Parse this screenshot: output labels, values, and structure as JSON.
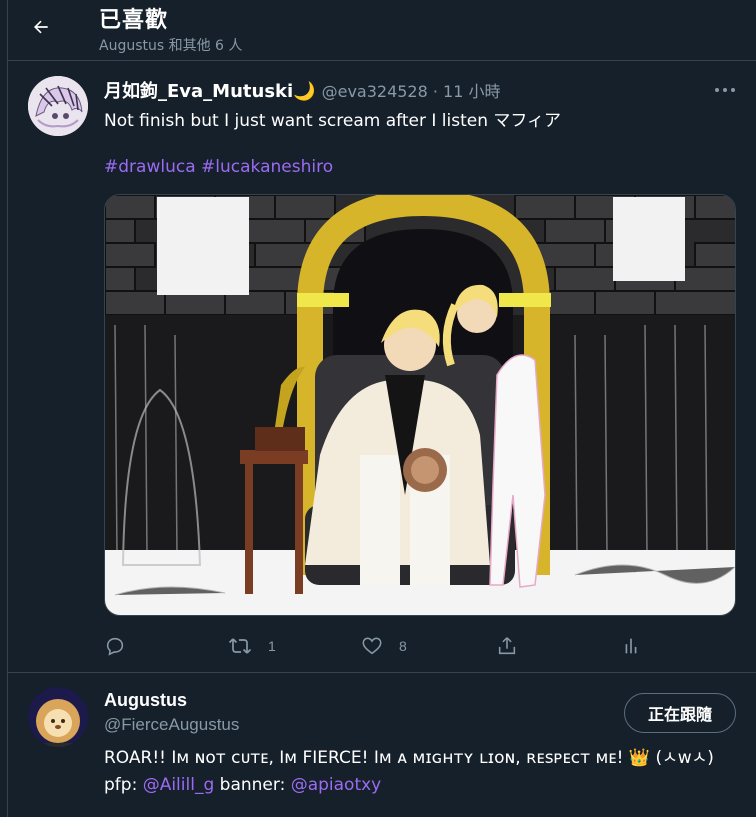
{
  "header": {
    "title": "已喜歡",
    "subtitle": "Augustus 和其他 6 人"
  },
  "tweet": {
    "display_name": "月如鉤_Eva_Mutuski🌙",
    "handle_time": "@eva324528 · 11 小時",
    "text": "Not finish but I just want scream after I listen マフィア",
    "hashtags": [
      "#drawluca",
      "#lucakaneshiro"
    ],
    "actions": {
      "retweet_count": "1",
      "like_count": "8"
    }
  },
  "user": {
    "display_name": "Augustus",
    "handle": "@FierceAugustus",
    "follow_label": "正在跟隨",
    "bio_text": "ROAR!! Iᴍ ɴᴏᴛ ᴄᴜᴛᴇ, Iᴍ FIERCE! Iᴍ ᴀ ᴍɪɢʜᴛʏ ʟɪᴏɴ, ʀᴇsᴘᴇᴄᴛ ᴍᴇ!",
    "bio_emoji": "👑",
    "bio_face": "(ㅅwㅅ)",
    "pfp_label": "pfp:",
    "pfp_link": "@Ailill_g",
    "banner_label": "banner:",
    "banner_link": "@apiaotxy"
  },
  "colors": {
    "background": "#15202b",
    "border": "#38444d",
    "secondary_text": "#8899a6",
    "link": "#9b6bf2"
  },
  "icons": {
    "back": "arrow-left-icon",
    "more": "more-dots-icon",
    "reply": "reply-bubble-icon",
    "retweet": "retweet-icon",
    "like": "heart-icon",
    "share": "share-icon",
    "analytics": "analytics-bars-icon"
  }
}
